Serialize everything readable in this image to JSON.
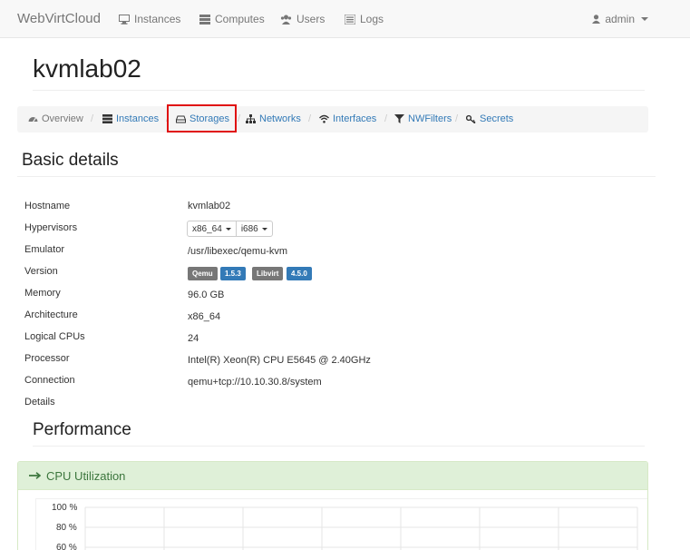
{
  "navbar": {
    "brand": "WebVirtCloud",
    "items": [
      {
        "label": "Instances",
        "icon": "desktop-icon"
      },
      {
        "label": "Computes",
        "icon": "server-icon"
      },
      {
        "label": "Users",
        "icon": "users-icon"
      },
      {
        "label": "Logs",
        "icon": "list-icon"
      }
    ],
    "user": "admin"
  },
  "page": {
    "title": "kvmlab02"
  },
  "tabs": [
    {
      "label": "Overview",
      "icon": "dashboard-icon",
      "active": true
    },
    {
      "label": "Instances",
      "icon": "server-icon",
      "active": false
    },
    {
      "label": "Storages",
      "icon": "hdd-icon",
      "active": false
    },
    {
      "label": "Networks",
      "icon": "sitemap-icon",
      "active": false
    },
    {
      "label": "Interfaces",
      "icon": "wifi-icon",
      "active": false
    },
    {
      "label": "NWFilters",
      "icon": "filter-icon",
      "active": false
    },
    {
      "label": "Secrets",
      "icon": "key-icon",
      "active": false
    }
  ],
  "details": {
    "heading": "Basic details",
    "labels": {
      "hostname": "Hostname",
      "hypervisors": "Hypervisors",
      "emulator": "Emulator",
      "version": "Version",
      "memory": "Memory",
      "architecture": "Architecture",
      "cpus": "Logical CPUs",
      "processor": "Processor",
      "connection": "Connection",
      "details": "Details"
    },
    "values": {
      "hostname": "kvmlab02",
      "hypervisors": [
        "x86_64",
        "i686"
      ],
      "emulator": "/usr/libexec/qemu-kvm",
      "version": {
        "qemu_label": "Qemu",
        "qemu": "1.5.3",
        "libvirt_label": "Libvirt",
        "libvirt": "4.5.0"
      },
      "memory": "96.0 GB",
      "architecture": "x86_64",
      "cpus": "24",
      "processor": "Intel(R) Xeon(R) CPU E5645 @ 2.40GHz",
      "connection": "qemu+tcp://10.10.30.8/system"
    }
  },
  "performance": {
    "heading": "Performance",
    "panel_title": "CPU Utilization",
    "y_ticks": [
      "100 %",
      "80 %",
      "60 %"
    ]
  },
  "colors": {
    "link": "#337ab7",
    "highlight": "#e01010",
    "panel_bg": "#dff0d8",
    "panel_text": "#3c763d"
  }
}
